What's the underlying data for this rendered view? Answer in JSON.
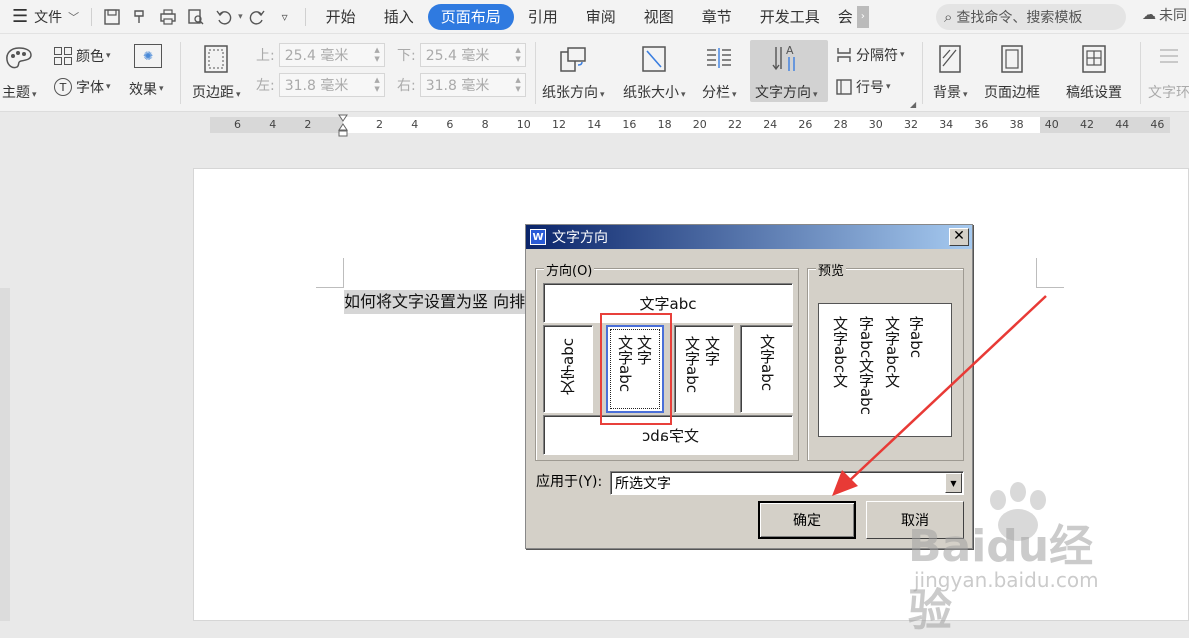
{
  "menubar": {
    "file_label": "文件",
    "tabs": [
      "开始",
      "插入",
      "页面布局",
      "引用",
      "审阅",
      "视图",
      "章节",
      "开发工具",
      "会"
    ],
    "active_tab": "页面布局",
    "search_placeholder": "查找命令、搜索模板",
    "cloud_label": "未同"
  },
  "ribbon": {
    "theme_label": "主题",
    "color_label": "颜色",
    "font_label": "字体",
    "effect_label": "效果",
    "margin_label": "页边距",
    "top_label": "上:",
    "top_value": "25.4 毫米",
    "bottom_label": "下:",
    "bottom_value": "25.4 毫米",
    "left_label": "左:",
    "left_value": "31.8 毫米",
    "right_label": "右:",
    "right_value": "31.8 毫米",
    "orientation_label": "纸张方向",
    "size_label": "纸张大小",
    "columns_label": "分栏",
    "text_direction_label": "文字方向",
    "separator_label": "分隔符",
    "line_number_label": "行号",
    "background_label": "背景",
    "page_border_label": "页面边框",
    "manuscript_label": "稿纸设置",
    "text_wrap_label": "文字环"
  },
  "ruler": {
    "labels": [
      "6",
      "4",
      "2",
      "2",
      "4",
      "6",
      "8",
      "10",
      "12",
      "14",
      "16",
      "18",
      "20",
      "22",
      "24",
      "26",
      "28",
      "30",
      "32",
      "34",
      "36",
      "38",
      "40",
      "42",
      "44",
      "46"
    ]
  },
  "document": {
    "text": "如何将文字设置为竖 向排"
  },
  "dialog": {
    "title": "文字方向",
    "direction_group": "方向(O)",
    "preview_group": "预览",
    "options": {
      "horizontal": "文字abc",
      "vertical_ccw": "文字abc",
      "selected_col1": "文字",
      "selected_col2": "文字abc",
      "vertical_col1": "文字",
      "vertical_col2": "文字abc",
      "vertical_cw": "文字abc",
      "flipped": "文字abc"
    },
    "preview_lines": [
      "字abc",
      "文字abc文",
      "字abc文字abc",
      "文字abc文"
    ],
    "apply_label": "应用于(Y):",
    "apply_value": "所选文字",
    "ok_label": "确定",
    "cancel_label": "取消"
  },
  "watermark": {
    "brand": "Baidu经验",
    "url": "jingyan.baidu.com"
  }
}
